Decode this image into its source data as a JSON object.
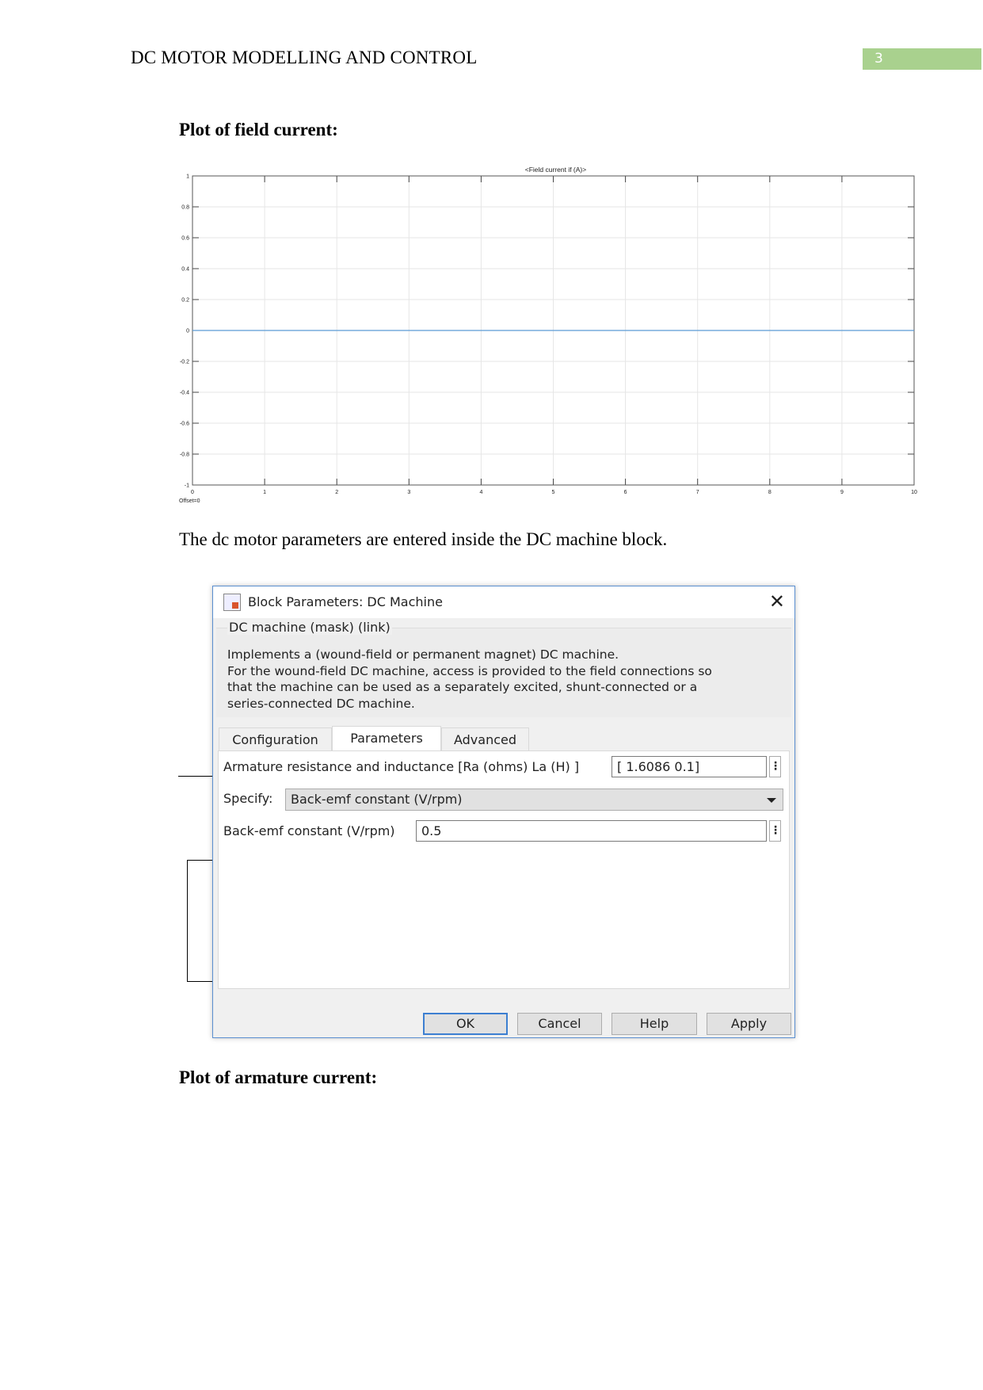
{
  "header": {
    "title": "DC MOTOR MODELLING AND CONTROL",
    "page_number": "3",
    "accent_color": "#a9d18e"
  },
  "section1": {
    "heading": "Plot of field current:"
  },
  "chart_data": {
    "type": "line",
    "title": "<Field current if (A)>",
    "xlim": [
      0,
      10
    ],
    "ylim": [
      -1,
      1
    ],
    "xticks": [
      "0",
      "1",
      "2",
      "3",
      "4",
      "5",
      "6",
      "7",
      "8",
      "9",
      "10"
    ],
    "yticks": [
      "1",
      "0.8",
      "0.6",
      "0.4",
      "0.2",
      "0",
      "-0.2",
      "-0.4",
      "-0.6",
      "-0.8",
      "-1"
    ],
    "grid": true,
    "annotation": "Offset=0",
    "series": [
      {
        "x": [
          0,
          10
        ],
        "y": [
          0,
          0
        ],
        "color": "#5b9bd5"
      }
    ]
  },
  "paragraph": "The dc motor parameters are entered inside the DC machine block.",
  "dialog": {
    "title": "Block Parameters: DC Machine",
    "group_label": "DC machine (mask) (link)",
    "description": [
      "Implements a (wound-field or permanent magnet) DC machine.",
      "For the wound-field DC machine, access is provided to the field connections so",
      "that the machine can be used as a separately excited, shunt-connected or a",
      "series-connected  DC machine."
    ],
    "tabs": [
      {
        "label": "Configuration"
      },
      {
        "label": "Parameters",
        "active": true
      },
      {
        "label": "Advanced"
      }
    ],
    "fields": {
      "armature_label": "Armature resistance and inductance [Ra (ohms) La (H) ]",
      "armature_value": "[ 1.6086  0.1]",
      "specify_label": "Specify:",
      "specify_value": "Back-emf constant (V/rpm)",
      "backemf_label": "Back-emf constant (V/rpm)",
      "backemf_value": "0.5"
    },
    "buttons": {
      "ok": "OK",
      "cancel": "Cancel",
      "help": "Help",
      "apply": "Apply"
    }
  },
  "section2": {
    "heading": "Plot of armature current:"
  }
}
